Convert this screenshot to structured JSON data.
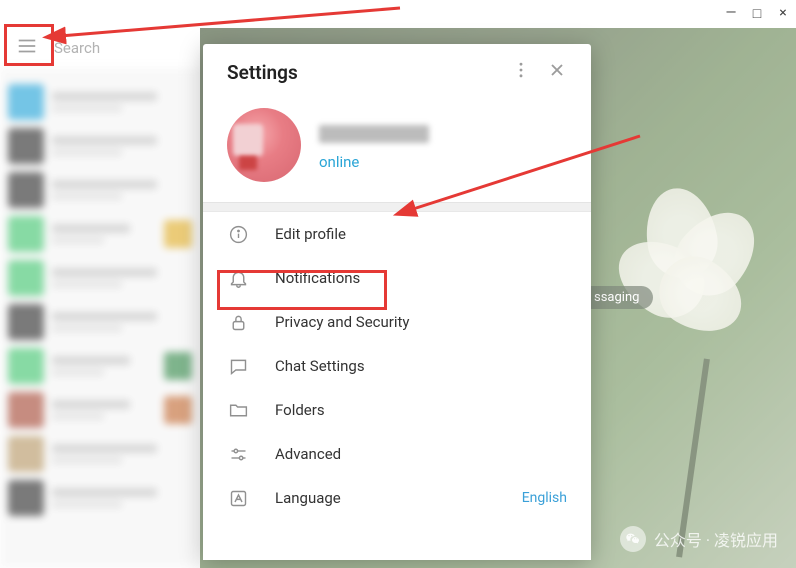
{
  "window": {
    "minimize": "—",
    "maximize": "□",
    "close": "×"
  },
  "search": {
    "placeholder": "Search"
  },
  "settings": {
    "title": "Settings",
    "status": "online",
    "items": {
      "edit_profile": "Edit profile",
      "notifications": "Notifications",
      "privacy": "Privacy and Security",
      "chat": "Chat Settings",
      "folders": "Folders",
      "advanced": "Advanced",
      "language": {
        "label": "Language",
        "value": "English"
      }
    }
  },
  "background": {
    "badge": "ssaging"
  },
  "watermark": {
    "text": "公众号 · 凌锐应用"
  },
  "chat_colors": [
    "#2aa6d9",
    "#333",
    "#333",
    "#48c774",
    "#48c774",
    "#333",
    "#48c774",
    "#a84f3c",
    "#b89a6a",
    "#333"
  ],
  "thumbs": {
    "3": "#e0b030",
    "6": "#3a8c4f",
    "7": "#c46f3a"
  }
}
